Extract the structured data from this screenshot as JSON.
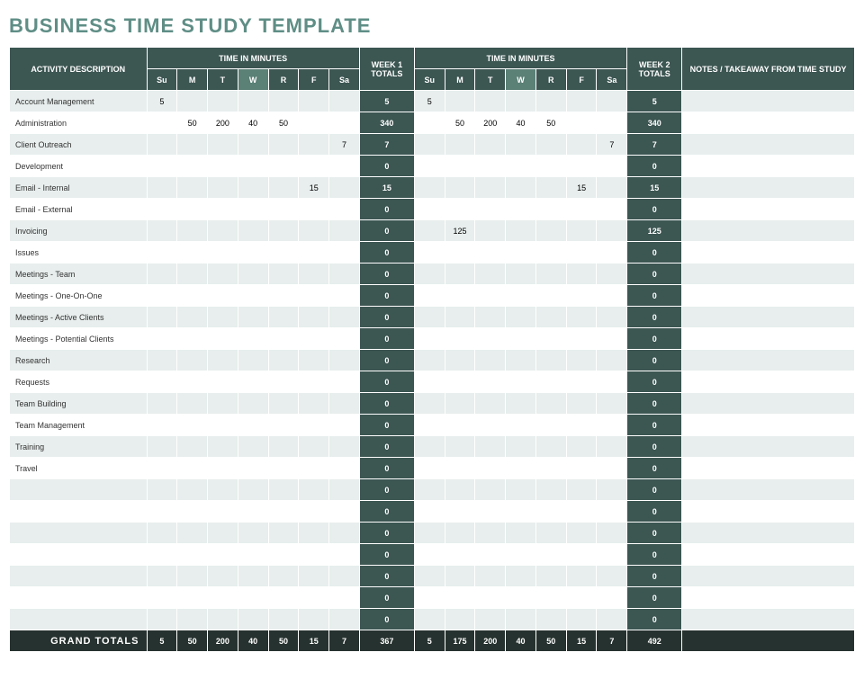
{
  "title": "BUSINESS TIME STUDY TEMPLATE",
  "headers": {
    "activity": "ACTIVITY DESCRIPTION",
    "time_in_minutes": "TIME IN MINUTES",
    "week1_totals": "WEEK 1 TOTALS",
    "week2_totals": "WEEK 2 TOTALS",
    "notes": "NOTES / TAKEAWAY FROM TIME STUDY",
    "days": [
      "Su",
      "M",
      "T",
      "W",
      "R",
      "F",
      "Sa"
    ]
  },
  "rows": [
    {
      "activity": "Account Management",
      "w1": [
        "5",
        "",
        "",
        "",
        "",
        "",
        ""
      ],
      "t1": "5",
      "w2": [
        "5",
        "",
        "",
        "",
        "",
        "",
        ""
      ],
      "t2": "5",
      "notes": ""
    },
    {
      "activity": "Administration",
      "w1": [
        "",
        "50",
        "200",
        "40",
        "50",
        "",
        ""
      ],
      "t1": "340",
      "w2": [
        "",
        "50",
        "200",
        "40",
        "50",
        "",
        ""
      ],
      "t2": "340",
      "notes": ""
    },
    {
      "activity": "Client Outreach",
      "w1": [
        "",
        "",
        "",
        "",
        "",
        "",
        "7"
      ],
      "t1": "7",
      "w2": [
        "",
        "",
        "",
        "",
        "",
        "",
        "7"
      ],
      "t2": "7",
      "notes": ""
    },
    {
      "activity": "Development",
      "w1": [
        "",
        "",
        "",
        "",
        "",
        "",
        ""
      ],
      "t1": "0",
      "w2": [
        "",
        "",
        "",
        "",
        "",
        "",
        ""
      ],
      "t2": "0",
      "notes": ""
    },
    {
      "activity": "Email - Internal",
      "w1": [
        "",
        "",
        "",
        "",
        "",
        "15",
        ""
      ],
      "t1": "15",
      "w2": [
        "",
        "",
        "",
        "",
        "",
        "15",
        ""
      ],
      "t2": "15",
      "notes": ""
    },
    {
      "activity": "Email - External",
      "w1": [
        "",
        "",
        "",
        "",
        "",
        "",
        ""
      ],
      "t1": "0",
      "w2": [
        "",
        "",
        "",
        "",
        "",
        "",
        ""
      ],
      "t2": "0",
      "notes": ""
    },
    {
      "activity": "Invoicing",
      "w1": [
        "",
        "",
        "",
        "",
        "",
        "",
        ""
      ],
      "t1": "0",
      "w2": [
        "",
        "125",
        "",
        "",
        "",
        "",
        ""
      ],
      "t2": "125",
      "notes": ""
    },
    {
      "activity": "Issues",
      "w1": [
        "",
        "",
        "",
        "",
        "",
        "",
        ""
      ],
      "t1": "0",
      "w2": [
        "",
        "",
        "",
        "",
        "",
        "",
        ""
      ],
      "t2": "0",
      "notes": ""
    },
    {
      "activity": "Meetings - Team",
      "w1": [
        "",
        "",
        "",
        "",
        "",
        "",
        ""
      ],
      "t1": "0",
      "w2": [
        "",
        "",
        "",
        "",
        "",
        "",
        ""
      ],
      "t2": "0",
      "notes": ""
    },
    {
      "activity": "Meetings - One-On-One",
      "w1": [
        "",
        "",
        "",
        "",
        "",
        "",
        ""
      ],
      "t1": "0",
      "w2": [
        "",
        "",
        "",
        "",
        "",
        "",
        ""
      ],
      "t2": "0",
      "notes": ""
    },
    {
      "activity": "Meetings - Active Clients",
      "w1": [
        "",
        "",
        "",
        "",
        "",
        "",
        ""
      ],
      "t1": "0",
      "w2": [
        "",
        "",
        "",
        "",
        "",
        "",
        ""
      ],
      "t2": "0",
      "notes": ""
    },
    {
      "activity": "Meetings - Potential Clients",
      "w1": [
        "",
        "",
        "",
        "",
        "",
        "",
        ""
      ],
      "t1": "0",
      "w2": [
        "",
        "",
        "",
        "",
        "",
        "",
        ""
      ],
      "t2": "0",
      "notes": ""
    },
    {
      "activity": "Research",
      "w1": [
        "",
        "",
        "",
        "",
        "",
        "",
        ""
      ],
      "t1": "0",
      "w2": [
        "",
        "",
        "",
        "",
        "",
        "",
        ""
      ],
      "t2": "0",
      "notes": ""
    },
    {
      "activity": "Requests",
      "w1": [
        "",
        "",
        "",
        "",
        "",
        "",
        ""
      ],
      "t1": "0",
      "w2": [
        "",
        "",
        "",
        "",
        "",
        "",
        ""
      ],
      "t2": "0",
      "notes": ""
    },
    {
      "activity": "Team Building",
      "w1": [
        "",
        "",
        "",
        "",
        "",
        "",
        ""
      ],
      "t1": "0",
      "w2": [
        "",
        "",
        "",
        "",
        "",
        "",
        ""
      ],
      "t2": "0",
      "notes": ""
    },
    {
      "activity": "Team Management",
      "w1": [
        "",
        "",
        "",
        "",
        "",
        "",
        ""
      ],
      "t1": "0",
      "w2": [
        "",
        "",
        "",
        "",
        "",
        "",
        ""
      ],
      "t2": "0",
      "notes": ""
    },
    {
      "activity": "Training",
      "w1": [
        "",
        "",
        "",
        "",
        "",
        "",
        ""
      ],
      "t1": "0",
      "w2": [
        "",
        "",
        "",
        "",
        "",
        "",
        ""
      ],
      "t2": "0",
      "notes": ""
    },
    {
      "activity": "Travel",
      "w1": [
        "",
        "",
        "",
        "",
        "",
        "",
        ""
      ],
      "t1": "0",
      "w2": [
        "",
        "",
        "",
        "",
        "",
        "",
        ""
      ],
      "t2": "0",
      "notes": ""
    },
    {
      "activity": "",
      "w1": [
        "",
        "",
        "",
        "",
        "",
        "",
        ""
      ],
      "t1": "0",
      "w2": [
        "",
        "",
        "",
        "",
        "",
        "",
        ""
      ],
      "t2": "0",
      "notes": ""
    },
    {
      "activity": "",
      "w1": [
        "",
        "",
        "",
        "",
        "",
        "",
        ""
      ],
      "t1": "0",
      "w2": [
        "",
        "",
        "",
        "",
        "",
        "",
        ""
      ],
      "t2": "0",
      "notes": ""
    },
    {
      "activity": "",
      "w1": [
        "",
        "",
        "",
        "",
        "",
        "",
        ""
      ],
      "t1": "0",
      "w2": [
        "",
        "",
        "",
        "",
        "",
        "",
        ""
      ],
      "t2": "0",
      "notes": ""
    },
    {
      "activity": "",
      "w1": [
        "",
        "",
        "",
        "",
        "",
        "",
        ""
      ],
      "t1": "0",
      "w2": [
        "",
        "",
        "",
        "",
        "",
        "",
        ""
      ],
      "t2": "0",
      "notes": ""
    },
    {
      "activity": "",
      "w1": [
        "",
        "",
        "",
        "",
        "",
        "",
        ""
      ],
      "t1": "0",
      "w2": [
        "",
        "",
        "",
        "",
        "",
        "",
        ""
      ],
      "t2": "0",
      "notes": ""
    },
    {
      "activity": "",
      "w1": [
        "",
        "",
        "",
        "",
        "",
        "",
        ""
      ],
      "t1": "0",
      "w2": [
        "",
        "",
        "",
        "",
        "",
        "",
        ""
      ],
      "t2": "0",
      "notes": ""
    },
    {
      "activity": "",
      "w1": [
        "",
        "",
        "",
        "",
        "",
        "",
        ""
      ],
      "t1": "0",
      "w2": [
        "",
        "",
        "",
        "",
        "",
        "",
        ""
      ],
      "t2": "0",
      "notes": ""
    }
  ],
  "grand": {
    "label": "GRAND TOTALS",
    "w1": [
      "5",
      "50",
      "200",
      "40",
      "50",
      "15",
      "7"
    ],
    "t1": "367",
    "w2": [
      "5",
      "175",
      "200",
      "40",
      "50",
      "15",
      "7"
    ],
    "t2": "492",
    "notes": ""
  }
}
